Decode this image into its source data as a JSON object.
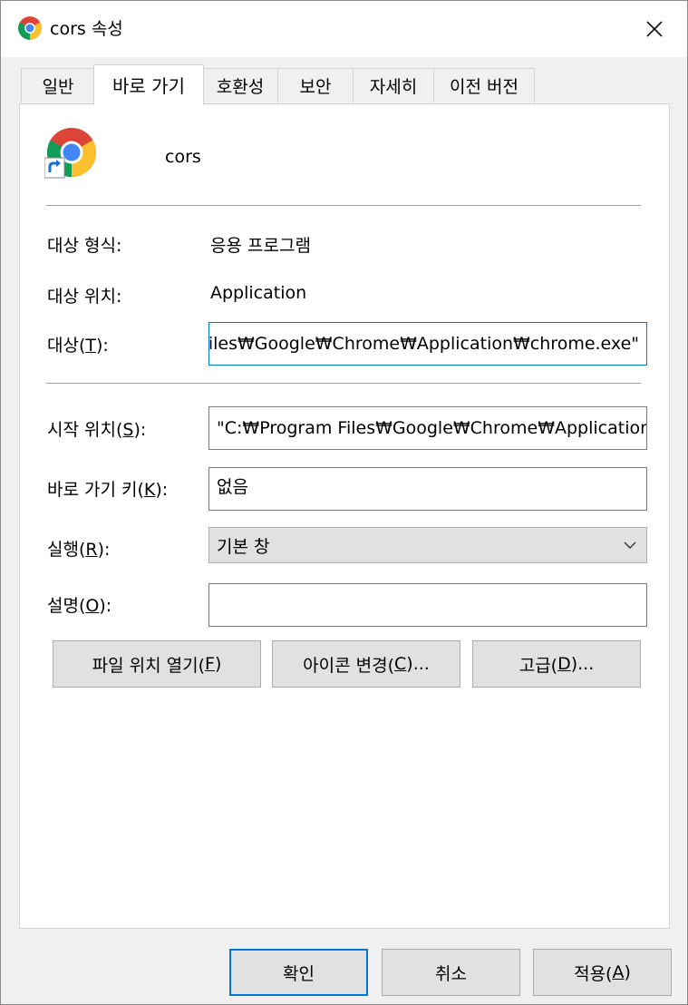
{
  "window": {
    "title": "cors 속성",
    "title_icon": "chrome-icon",
    "close_icon": "close-icon"
  },
  "tabs": [
    {
      "label": "일반",
      "active": false
    },
    {
      "label": "바로 가기",
      "active": true
    },
    {
      "label": "호환성",
      "active": false
    },
    {
      "label": "보안",
      "active": false
    },
    {
      "label": "자세히",
      "active": false
    },
    {
      "label": "이전 버전",
      "active": false
    }
  ],
  "shortcut": {
    "name": "cors",
    "icon": "chrome-shortcut-icon",
    "target_type_label": "대상 형식:",
    "target_type_value": "응용 프로그램",
    "target_location_label": "대상 위치:",
    "target_location_value": "Application",
    "target_label_pre": "대상(",
    "target_label_key": "T",
    "target_label_post": "):",
    "target_value": "Files₩Google₩Chrome₩Application₩chrome.exe\"",
    "start_in_label_pre": "시작 위치(",
    "start_in_label_key": "S",
    "start_in_label_post": "):",
    "start_in_value": "\"C:₩Program Files₩Google₩Chrome₩Application\"",
    "shortcut_key_label_pre": "바로 가기 키(",
    "shortcut_key_label_key": "K",
    "shortcut_key_label_post": "):",
    "shortcut_key_value": "없음",
    "run_label_pre": "실행(",
    "run_label_key": "R",
    "run_label_post": "):",
    "run_value": "기본 창",
    "comment_label_pre": "설명(",
    "comment_label_key": "O",
    "comment_label_post": "):",
    "comment_value": ""
  },
  "actions": {
    "open_location_pre": "파일 위치 열기(",
    "open_location_key": "F",
    "open_location_post": ")",
    "change_icon_pre": "아이콘 변경(",
    "change_icon_key": "C",
    "change_icon_post": ")...",
    "advanced_pre": "고급(",
    "advanced_key": "D",
    "advanced_post": ")..."
  },
  "footer": {
    "ok": "확인",
    "cancel": "취소",
    "apply_pre": "적용(",
    "apply_key": "A",
    "apply_post": ")"
  }
}
